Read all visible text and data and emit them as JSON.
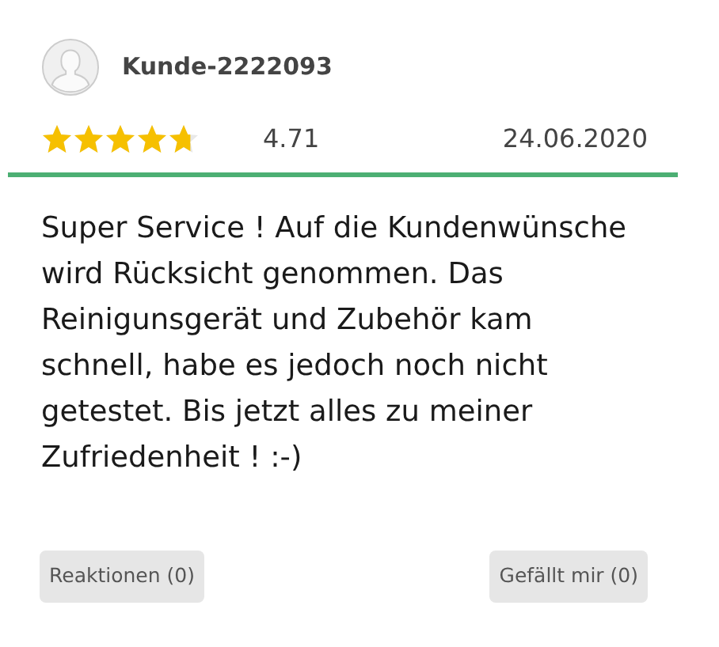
{
  "review": {
    "author": "Kunde-2222093",
    "stars": 4.71,
    "rating": "4.71",
    "date": "24.06.2020",
    "text": "Super Service ! Auf die Kundenwünsche wird Rücksicht genommen. Das Reinigunsgerät und Zubehör kam schnell, habe es jedoch noch nicht getestet. Bis jetzt alles zu meiner Zufriedenheit ! :-)",
    "buttons": [
      "Reaktionen (0)",
      "Gefällt mir (0)"
    ]
  }
}
